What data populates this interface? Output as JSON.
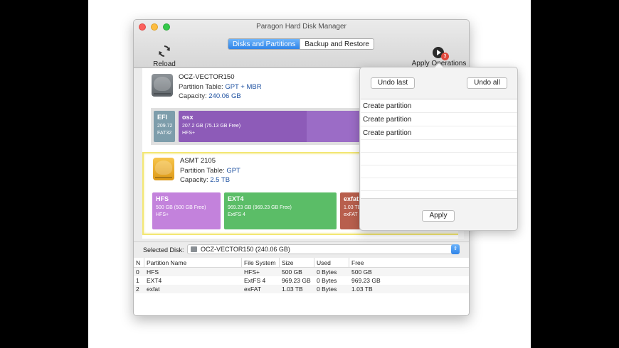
{
  "app": {
    "title": "Paragon Hard Disk Manager"
  },
  "tabs": [
    {
      "label": "Disks and Partitions",
      "active": true
    },
    {
      "label": "Backup and Restore",
      "active": false
    }
  ],
  "toolbar": {
    "reload_label": "Reload",
    "apply_label": "Apply Operations",
    "pending_count": "3"
  },
  "disks": [
    {
      "name": "OCZ-VECTOR150",
      "partition_table_label": "Partition Table:",
      "partition_table": "GPT + MBR",
      "capacity_label": "Capacity:",
      "capacity": "240.06 GB",
      "partitions": [
        {
          "name": "EFI",
          "size": "209.72",
          "fs": "FAT32"
        },
        {
          "name": "osx",
          "size": "207.2 GB (75.13 GB Free)",
          "fs": "HFS+"
        }
      ]
    },
    {
      "name": "ASMT 2105",
      "partition_table_label": "Partition Table:",
      "partition_table": "GPT",
      "capacity_label": "Capacity:",
      "capacity": "2.5 TB",
      "partitions": [
        {
          "name": "HFS",
          "size": "500 GB (500 GB Free)",
          "fs": "HFS+"
        },
        {
          "name": "EXT4",
          "size": "969.23 GB (969.23 GB Free)",
          "fs": "ExtFS 4"
        },
        {
          "name": "exfat",
          "size": "1.03 TB (1",
          "fs": "exFAT"
        }
      ]
    }
  ],
  "selected_disk": {
    "label": "Selected Disk:",
    "value": "OCZ-VECTOR150 (240.06 GB)"
  },
  "table": {
    "headers": [
      "N",
      "Partition Name",
      "File System",
      "Size",
      "Used",
      "Free"
    ],
    "rows": [
      [
        "0",
        "HFS",
        "HFS+",
        "500 GB",
        "0 Bytes",
        "500 GB"
      ],
      [
        "1",
        "EXT4",
        "ExtFS 4",
        "969.23 GB",
        "0 Bytes",
        "969.23 GB"
      ],
      [
        "2",
        "exfat",
        "exFAT",
        "1.03 TB",
        "0 Bytes",
        "1.03 TB"
      ]
    ]
  },
  "popover": {
    "undo_last": "Undo last",
    "undo_all": "Undo all",
    "operations": [
      "Create partition",
      "Create partition",
      "Create partition"
    ],
    "apply": "Apply"
  },
  "colors": {
    "efi": "#7d9dab",
    "osx": "#9b6cc6",
    "hfs": "#c382dc",
    "ext4": "#5bbd67",
    "exfat": "#b85f4d",
    "accent": "#2f84e8",
    "selected_disk_border": "#f3e774"
  }
}
